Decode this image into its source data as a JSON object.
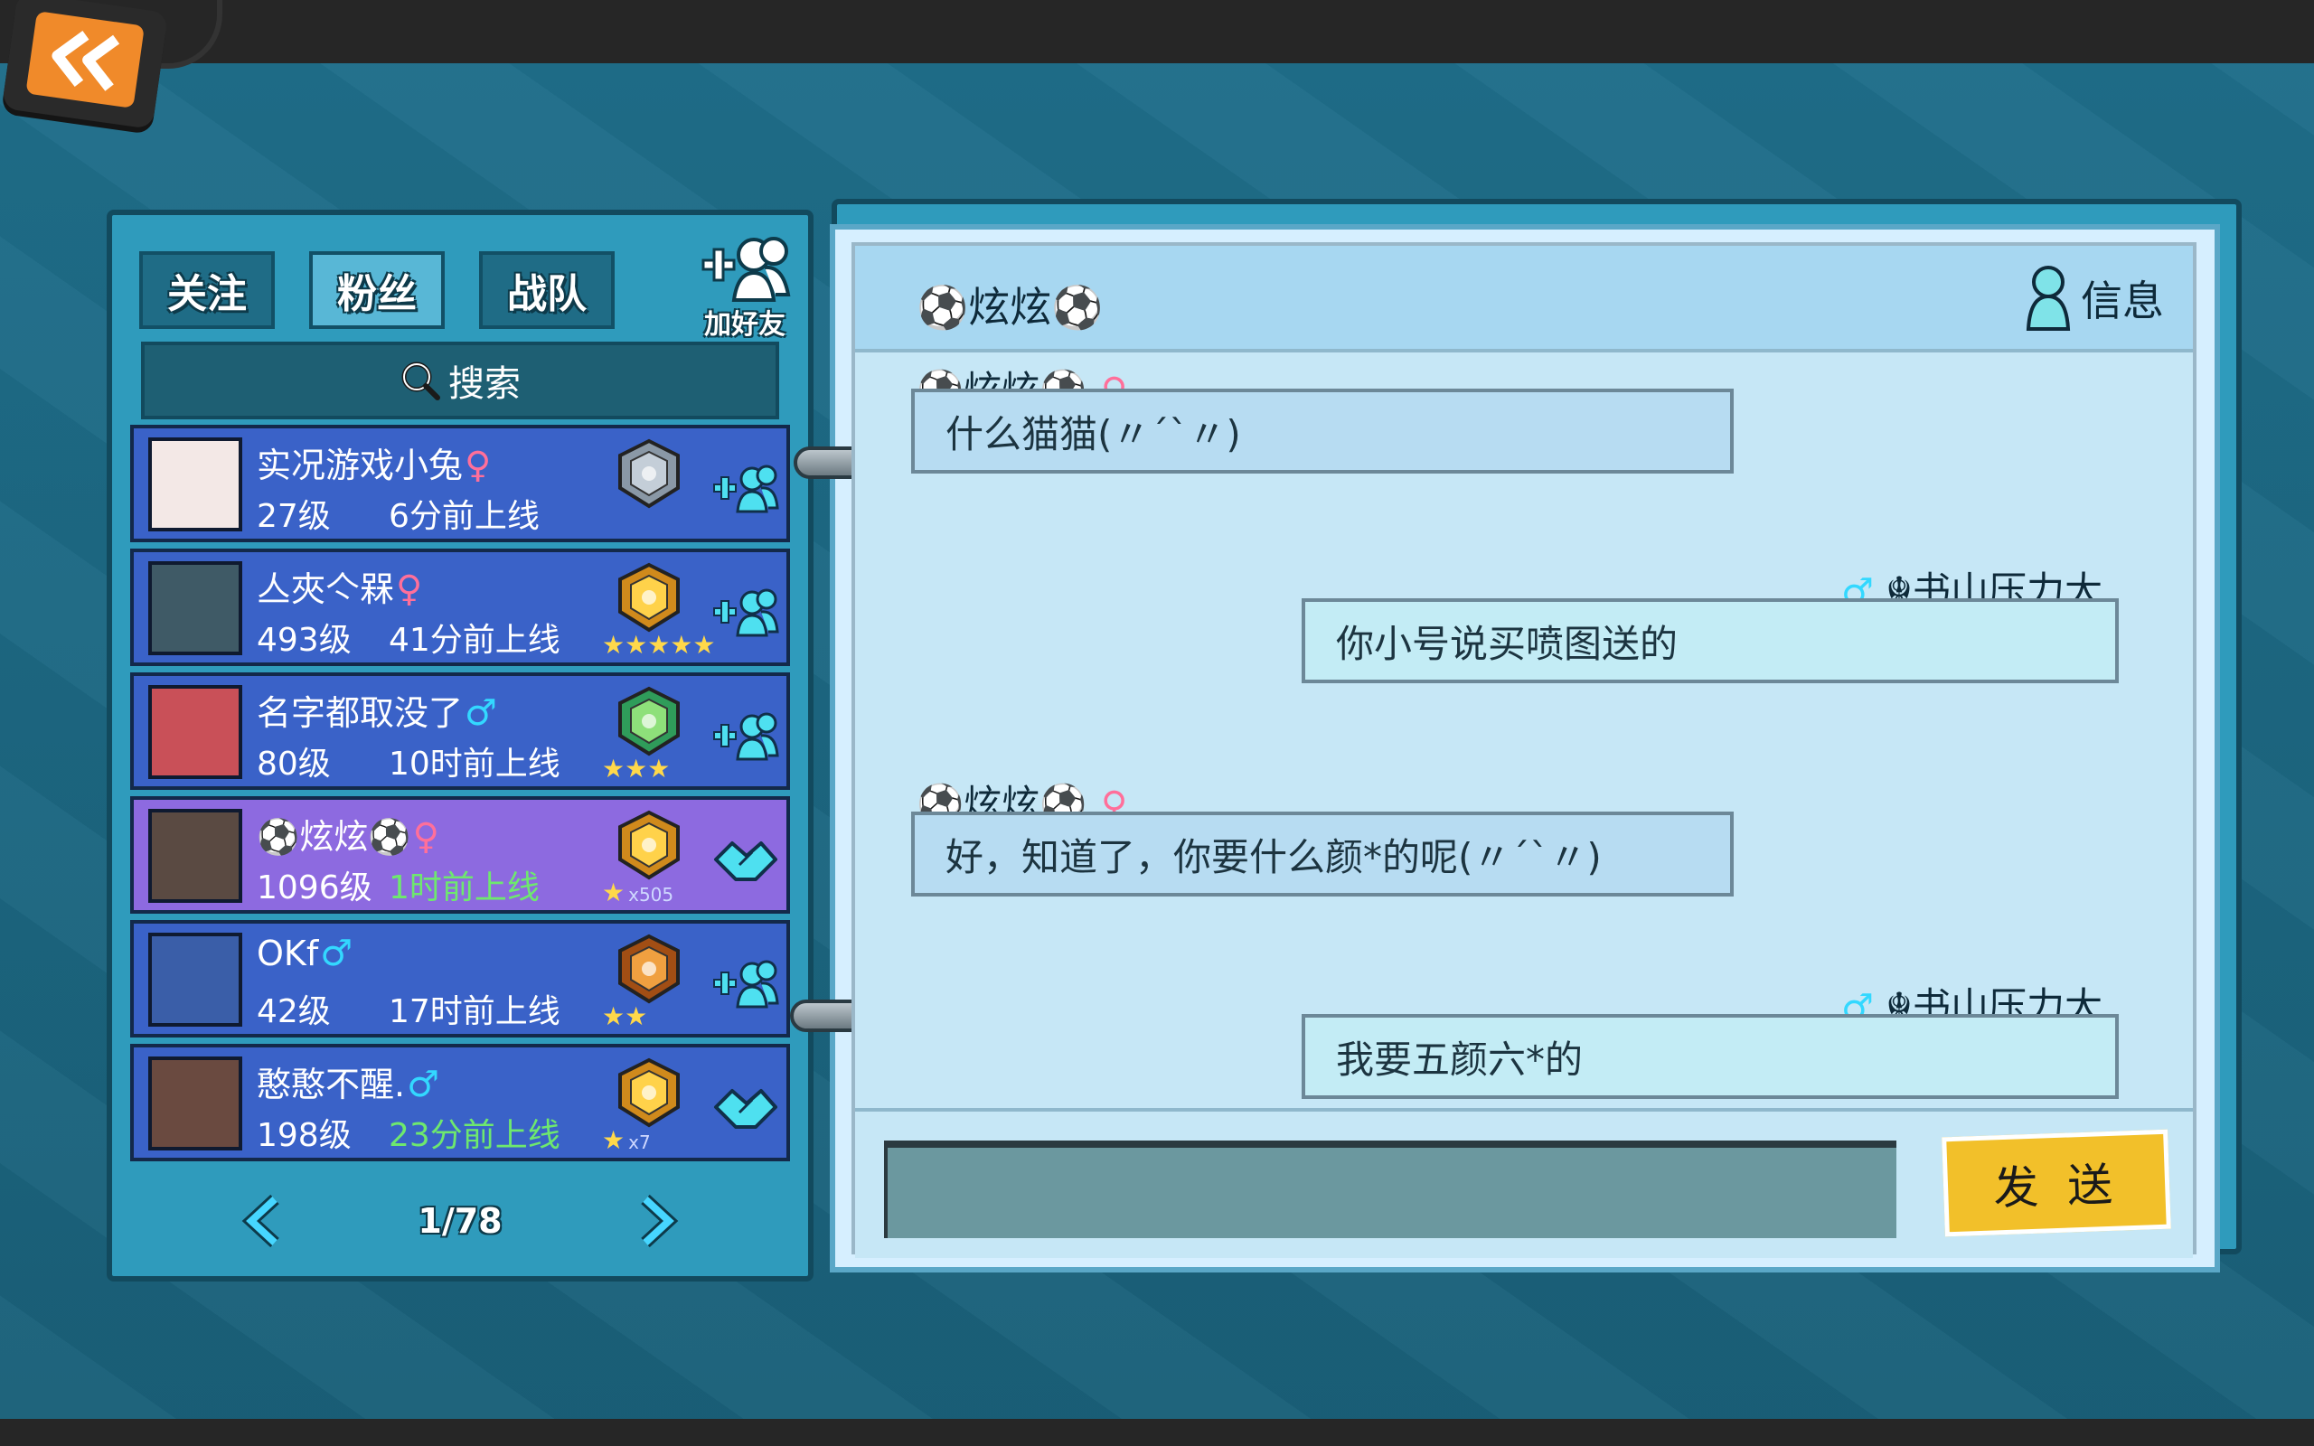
{
  "tabs": [
    {
      "label": "关注",
      "active": false
    },
    {
      "label": "粉丝",
      "active": true
    },
    {
      "label": "战队",
      "active": false
    }
  ],
  "add_friend_label": "加好友",
  "search_placeholder": "搜索",
  "friends": [
    {
      "name": "实况游戏小兔",
      "gender": "♀",
      "gender_type": "f",
      "level": "27级",
      "online": "6分前上线",
      "online_color": "white",
      "stars": "",
      "star_mult": "",
      "action": "add-friend-icon",
      "badge": "silver-rank-badge",
      "avatar_color": "#f3e8e6",
      "selected": false
    },
    {
      "name": "亼夾亽槑",
      "gender": "♀",
      "gender_type": "f",
      "level": "493级",
      "online": "41分前上线",
      "online_color": "white",
      "stars": "★★★★★",
      "star_mult": "",
      "action": "add-friend-icon",
      "badge": "gold-rank-badge",
      "avatar_color": "#3f5a66",
      "selected": false
    },
    {
      "name": "名字都取没了",
      "gender": "♂",
      "gender_type": "m",
      "level": "80级",
      "online": "10时前上线",
      "online_color": "white",
      "stars": "★★★",
      "star_mult": "",
      "action": "add-friend-icon",
      "badge": "green-rank-badge",
      "avatar_color": "#c95058",
      "selected": false
    },
    {
      "name": "⚽炫炫⚽",
      "gender": "♀",
      "gender_type": "f",
      "level": "1096级",
      "online": "1时前上线",
      "online_color": "green",
      "stars": "★",
      "star_mult": "x505",
      "action": "handshake-icon",
      "badge": "gold-rank-badge",
      "avatar_color": "#5a4a42",
      "selected": true
    },
    {
      "name": "OKf",
      "gender": "♂",
      "gender_type": "m",
      "level": "42级",
      "online": "17时前上线",
      "online_color": "white",
      "stars": "★★",
      "star_mult": "",
      "action": "add-friend-icon",
      "badge": "bronze-rank-badge",
      "avatar_color": "#3a5ea8",
      "selected": false
    },
    {
      "name": "憨憨不醒.",
      "gender": "♂",
      "gender_type": "m",
      "level": "198级",
      "online": "23分前上线",
      "online_color": "green",
      "stars": "★",
      "star_mult": "x7",
      "action": "handshake-icon",
      "badge": "gold-rank-badge",
      "avatar_color": "#6a4a40",
      "selected": false
    }
  ],
  "pager": {
    "text": "1/78"
  },
  "chat": {
    "title": "⚽炫炫⚽",
    "info_label": "信息",
    "messages": [
      {
        "side": "left",
        "sender": "⚽炫炫⚽",
        "gender": "♀",
        "text": "什么猫猫(〃´`〃)"
      },
      {
        "side": "right",
        "sender": "☬书山压力大",
        "gender": "♂",
        "text": "你小号说买喷图送的"
      },
      {
        "side": "left",
        "sender": "⚽炫炫⚽",
        "gender": "♀",
        "text": "好，知道了，你要什么颜*的呢(〃´`〃)"
      },
      {
        "side": "right",
        "sender": "☬书山压力大",
        "gender": "♂",
        "text": "我要五颜六*的"
      },
      {
        "side": "right",
        "sender": "☬书山压力大",
        "gender": "♂",
        "text": ""
      }
    ],
    "input_value": "",
    "send_label": "发 送"
  },
  "colors": {
    "accent_orange": "#f08a2a",
    "row_blue": "#3a62c8",
    "row_selected": "#8d6ae0",
    "send_yellow": "#f2c02a"
  }
}
